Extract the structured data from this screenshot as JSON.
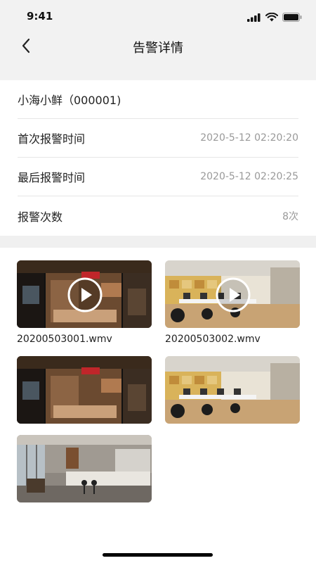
{
  "status": {
    "time": "9:41"
  },
  "nav": {
    "title": "告警详情"
  },
  "info": {
    "store_name": "小海小鲜（000001)",
    "first_alarm_label": "首次报警时间",
    "first_alarm_value": "2020-5-12 02:20:20",
    "last_alarm_label": "最后报警时间",
    "last_alarm_value": "2020-5-12 02:20:25",
    "alarm_count_label": "报警次数",
    "alarm_count_value": "8次"
  },
  "media": [
    {
      "type": "video",
      "scene": "storefront",
      "filename": "20200503001.wmv"
    },
    {
      "type": "video",
      "scene": "office",
      "filename": "20200503002.wmv"
    },
    {
      "type": "image",
      "scene": "storefront",
      "filename": ""
    },
    {
      "type": "image",
      "scene": "office",
      "filename": ""
    },
    {
      "type": "image",
      "scene": "lobby",
      "filename": ""
    }
  ],
  "icons": [
    "signal-icon",
    "wifi-icon",
    "battery-icon",
    "back-arrow-icon",
    "play-icon"
  ]
}
